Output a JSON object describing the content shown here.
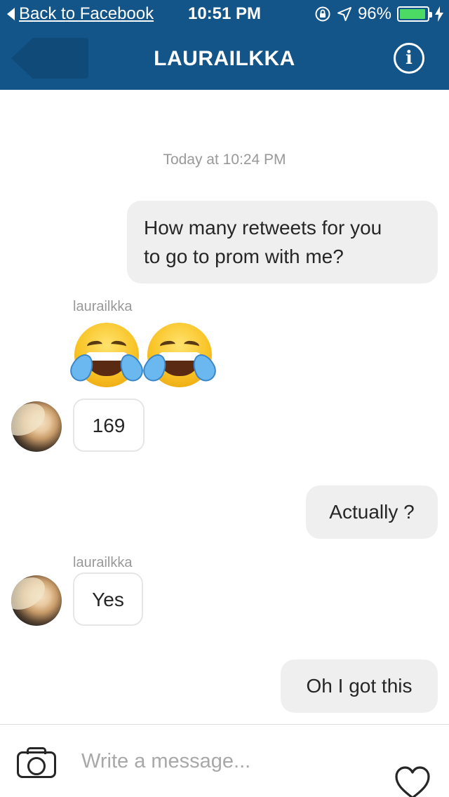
{
  "status_bar": {
    "back_app_label": "Back to Facebook",
    "time": "10:51 PM",
    "battery_text": "96%",
    "battery_level": 0.96
  },
  "nav": {
    "title": "LAURAILKKA",
    "info_glyph": "i"
  },
  "thread": {
    "timestamp": "Today at 10:24 PM",
    "messages": [
      {
        "direction": "outgoing",
        "lines": [
          "How many retweets for you",
          "to go to prom with me?"
        ]
      },
      {
        "direction": "incoming",
        "sender": "laurailkka",
        "emoji": [
          "face-with-tears-of-joy",
          "face-with-tears-of-joy"
        ],
        "text": "169"
      },
      {
        "direction": "outgoing",
        "text": "Actually ?"
      },
      {
        "direction": "incoming",
        "sender": "laurailkka",
        "text": "Yes"
      },
      {
        "direction": "outgoing",
        "text": "Oh I got this"
      }
    ]
  },
  "composer": {
    "placeholder": "Write a message...",
    "value": ""
  },
  "icons": {
    "back": "chevron-left-icon",
    "location": "location-arrow-icon",
    "rotation_lock": "rotation-lock-icon",
    "charging": "bolt-icon",
    "info": "info-icon",
    "camera": "camera-icon",
    "like": "heart-icon"
  },
  "colors": {
    "brand_bar": "#135489",
    "outgoing_bubble": "#efefef",
    "incoming_border": "#e6e6e6",
    "battery_fill": "#4cd964"
  }
}
